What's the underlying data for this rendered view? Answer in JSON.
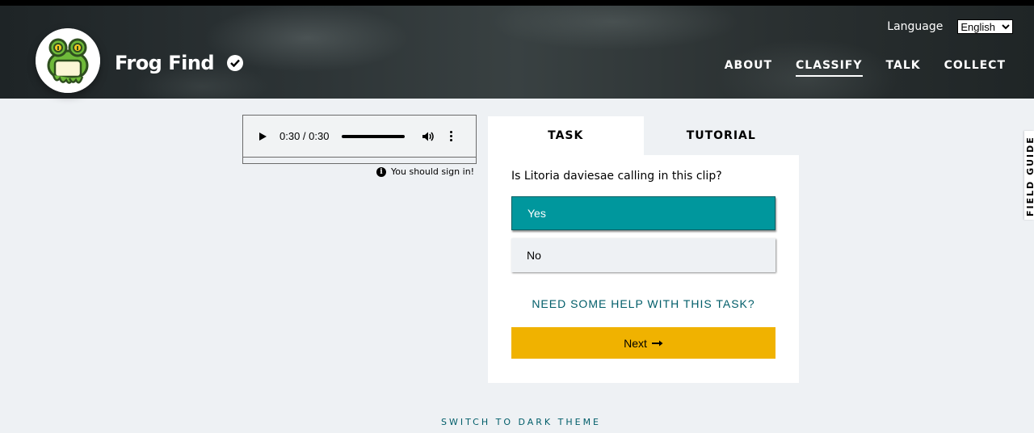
{
  "header": {
    "title": "Frog Find",
    "language_label": "Language",
    "language_selected": "English",
    "nav": [
      {
        "label": "ABOUT",
        "active": false
      },
      {
        "label": "CLASSIFY",
        "active": true
      },
      {
        "label": "TALK",
        "active": false
      },
      {
        "label": "COLLECT",
        "active": false
      }
    ]
  },
  "audio": {
    "time": "0:30 / 0:30",
    "signin_notice": "You should sign in!"
  },
  "task": {
    "tabs": [
      {
        "label": "TASK",
        "active": true
      },
      {
        "label": "TUTORIAL",
        "active": false
      }
    ],
    "question": "Is Litoria daviesae calling in this clip?",
    "answers": [
      {
        "label": "Yes",
        "selected": true
      },
      {
        "label": "No",
        "selected": false
      }
    ],
    "help_link": "NEED SOME HELP WITH THIS TASK?",
    "next_label": "Next"
  },
  "field_guide": {
    "label": "FIELD GUIDE"
  },
  "footer": {
    "theme_toggle": "SWITCH TO DARK THEME"
  },
  "colors": {
    "teal": "#00979d",
    "next_yellow": "#f0b200",
    "link_teal": "#005d69",
    "frog_green": "#6fba3a"
  },
  "icons": [
    "frog-logo-icon",
    "verified-check-icon",
    "play-icon",
    "volume-icon",
    "more-options-icon",
    "info-icon",
    "arrow-right-icon",
    "chevron-down-icon"
  ]
}
